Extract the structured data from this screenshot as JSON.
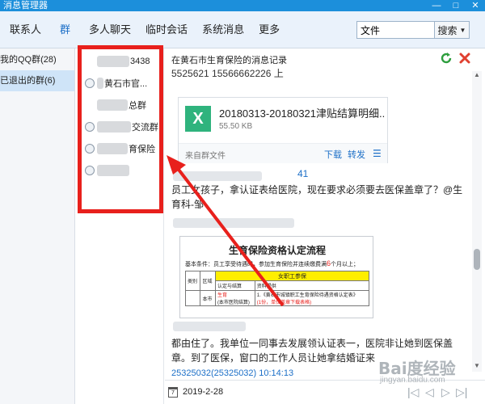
{
  "window": {
    "title": "消息管理器",
    "min": "—",
    "max": "□",
    "close": "✕"
  },
  "toolbar": {
    "menu": [
      "联系人",
      "群",
      "多人聊天",
      "临时会话",
      "系统消息",
      "更多"
    ],
    "search_value": "文件",
    "search_button": "搜索"
  },
  "leftpane": {
    "items": [
      "我的QQ群(28)",
      "已退出的群(6)"
    ]
  },
  "groups": [
    {
      "name": "3438"
    },
    {
      "name": "黄石市官..."
    },
    {
      "name": "总群"
    },
    {
      "name": "交流群"
    },
    {
      "name": "育保险"
    },
    {
      "name": ""
    }
  ],
  "chat": {
    "title": "在黄石市生育保险的消息记录",
    "top_fragment": "5525621  15566662226  上",
    "file": {
      "icon_letter": "X",
      "name": "20180313-20180321津贴结算明细...",
      "size": "55.50 KB",
      "from": "来自群文件",
      "download": "下载",
      "forward": "转发"
    },
    "id_fragment": "41",
    "message1": "员工女孩子，拿认证表给医院，现在要求必须要去医保盖章了？@生育科-邹",
    "doc": {
      "title": "生育保险资格认定流程",
      "note_prefix": "基本条件：员工享受待遇时，参加生育保险并连续缴费满",
      "note_num": "6",
      "note_suffix": "个月以上；",
      "header_hl": "女职工参保",
      "col_type": "类别",
      "col_area": "区域",
      "col_cert": "认定与结算",
      "col_data": "资料提供",
      "row_label": "生育",
      "row_sub": "(本市医院结算)",
      "row_note": "1.《黄石市城镇职工生育保险待遇资格认定表》",
      "row_red": "(1份，单位盖章下载表格)",
      "row_area": "本市"
    },
    "message2": "都由住了。我单位一同事去发展领认证表一，医院非让她到医保盖章。到了医保，窗口的工作人员让她拿结婚证来",
    "bottom_fragment": "25325032(25325032)  10:14:13",
    "date": "2019-2-28"
  },
  "watermark": {
    "main": "Bai度经验",
    "sub": "jingyan.baidu.com"
  },
  "colors": {
    "accent": "#1c8fdb",
    "highlight_box": "#e8201c",
    "excel": "#2fb37d"
  }
}
